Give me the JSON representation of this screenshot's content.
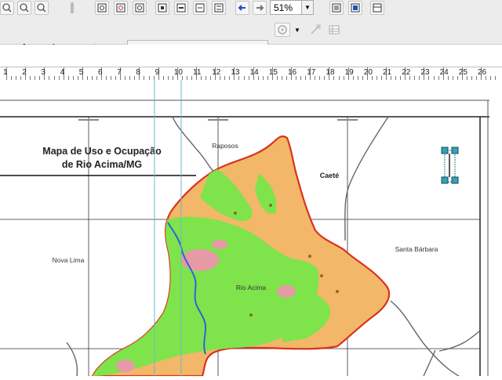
{
  "toolbar": {
    "zoom_value": "51%",
    "georeferencing_label": "eoreferencing",
    "layer_label": "Layer:",
    "layer_value": ""
  },
  "ruler": {
    "labels": [
      "1",
      "2",
      "3",
      "4",
      "5",
      "6",
      "7",
      "8",
      "9",
      "10",
      "11",
      "12",
      "13",
      "14",
      "15",
      "16",
      "17",
      "18",
      "19",
      "20",
      "21",
      "22",
      "23",
      "24",
      "25",
      "26"
    ]
  },
  "map": {
    "title_line1": "Mapa de Uso e Ocupação",
    "title_line2": "de Rio Acima/MG",
    "places": {
      "raposos": "Raposos",
      "caete": "Caeté",
      "nova_lima": "Nova Lima",
      "santa_barbara": "Santa Bárbara",
      "rio_acima": "Rio Acima"
    },
    "colors": {
      "urban_orange": "#F2B769",
      "vegetation_green": "#7FE34B",
      "river_blue": "#2E62E0",
      "boundary_red": "#D9331D",
      "urban_pink": "#E69AA6"
    }
  }
}
